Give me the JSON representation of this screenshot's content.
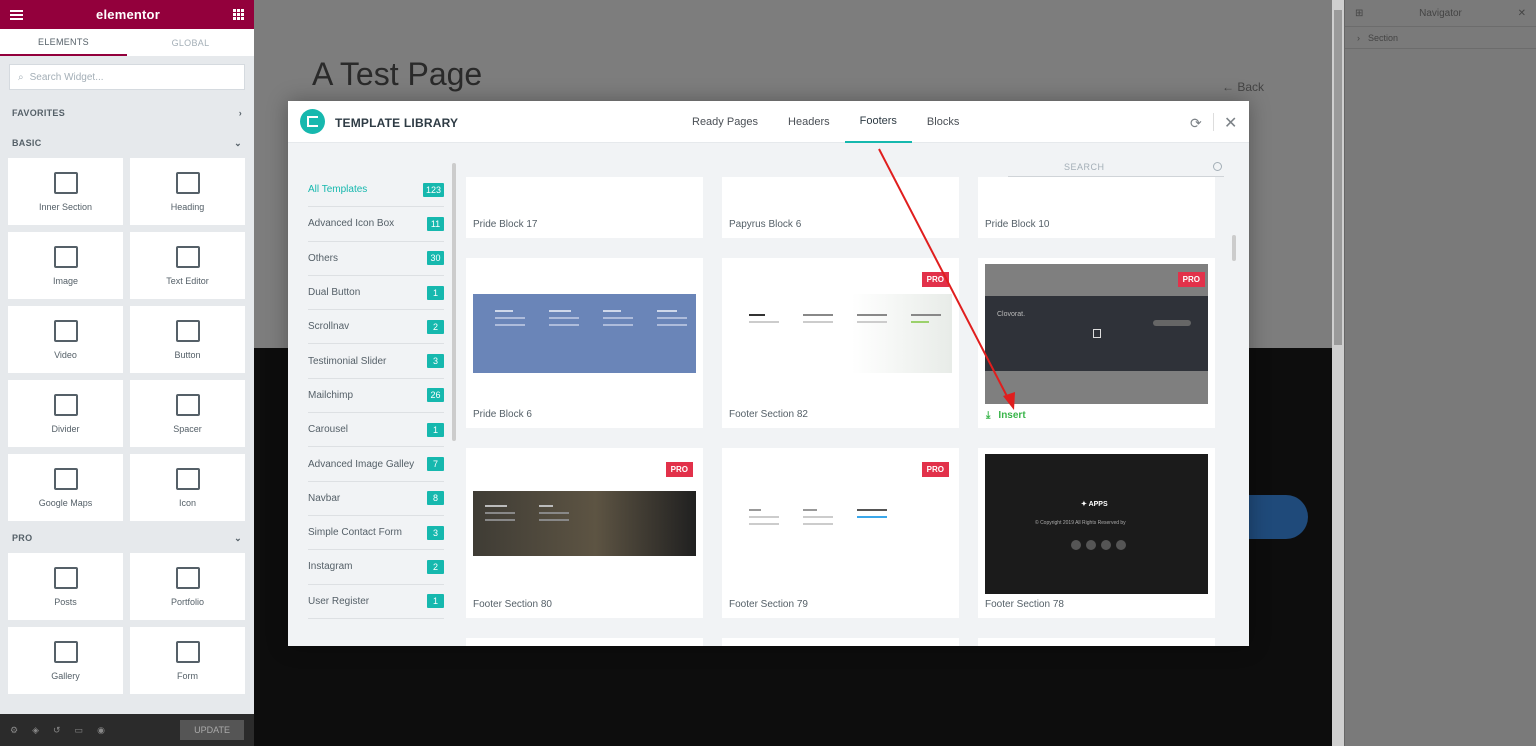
{
  "editor": {
    "logo": "elementor",
    "tabs": [
      "ELEMENTS",
      "GLOBAL"
    ],
    "search_placeholder": "Search Widget...",
    "categories": {
      "favorites": "FAVORITES",
      "basic": "BASIC",
      "pro": "PRO"
    },
    "basic_widgets": [
      "Inner Section",
      "Heading",
      "Image",
      "Text Editor",
      "Video",
      "Button",
      "Divider",
      "Spacer",
      "Google Maps",
      "Icon"
    ],
    "pro_widgets": [
      "Posts",
      "Portfolio",
      "Gallery",
      "Form"
    ],
    "update_label": "UPDATE"
  },
  "canvas": {
    "page_title": "A Test Page",
    "back_label": "Back"
  },
  "navigator": {
    "title": "Navigator",
    "row": "Section"
  },
  "modal": {
    "title": "TEMPLATE LIBRARY",
    "tabs": [
      {
        "label": "Ready Pages",
        "active": false
      },
      {
        "label": "Headers",
        "active": false
      },
      {
        "label": "Footers",
        "active": true
      },
      {
        "label": "Blocks",
        "active": false
      }
    ],
    "search_placeholder": "SEARCH",
    "categories": [
      {
        "label": "All Templates",
        "count": "123"
      },
      {
        "label": "Advanced Icon Box",
        "count": "11"
      },
      {
        "label": "Others",
        "count": "30"
      },
      {
        "label": "Dual Button",
        "count": "1"
      },
      {
        "label": "Scrollnav",
        "count": "2"
      },
      {
        "label": "Testimonial Slider",
        "count": "3"
      },
      {
        "label": "Mailchimp",
        "count": "26"
      },
      {
        "label": "Carousel",
        "count": "1"
      },
      {
        "label": "Advanced Image Galley",
        "count": "7"
      },
      {
        "label": "Navbar",
        "count": "8"
      },
      {
        "label": "Simple Contact Form",
        "count": "3"
      },
      {
        "label": "Instagram",
        "count": "2"
      },
      {
        "label": "User Register",
        "count": "1"
      }
    ],
    "cards": {
      "row0": [
        "Pride Block 17",
        "Papyrus Block 6",
        "Pride Block 10"
      ],
      "row1": [
        "Pride Block 6",
        "Footer Section 82",
        ""
      ],
      "row2": [
        "Footer Section 80",
        "Footer Section 79",
        "Footer Section 78"
      ]
    },
    "pro_badge": "PRO",
    "insert_label": "Insert",
    "thumb_text": {
      "clovorat": "Clovorat.",
      "apps": "APPS",
      "copyright": "© Copyright 2019 All Rights Reserved by"
    }
  },
  "colors": {
    "accent": "#16b8ae",
    "editor_brand": "#93003c",
    "pro_badge": "#e2314a",
    "insert": "#39b54a",
    "annotation_arrow": "#e01e1e"
  }
}
